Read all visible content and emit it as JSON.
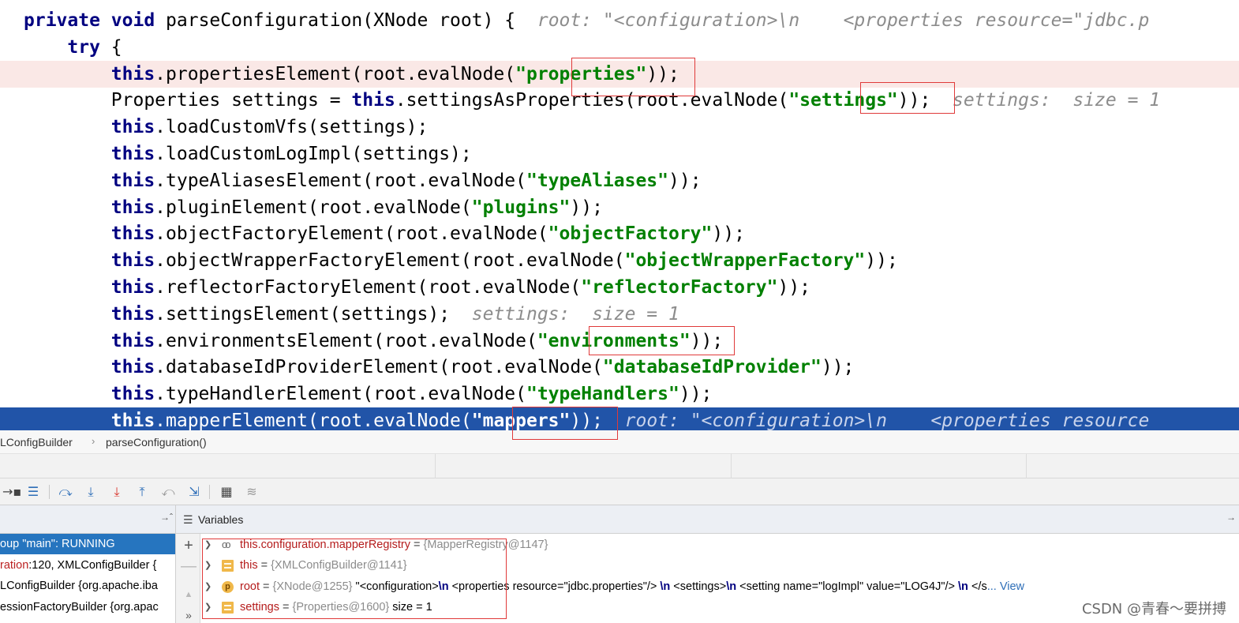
{
  "editor": {
    "lines": [
      {
        "state": "normal",
        "segments": [
          {
            "t": "private",
            "c": "kw"
          },
          {
            "t": " "
          },
          {
            "t": "void",
            "c": "kw"
          },
          {
            "t": " parseConfiguration(XNode root) {  "
          },
          {
            "t": "root: \"<configuration>\\n    <properties resource=\"jdbc.p",
            "c": "hint"
          }
        ]
      },
      {
        "state": "normal",
        "segments": [
          {
            "t": "    "
          },
          {
            "t": "try",
            "c": "kw"
          },
          {
            "t": " {"
          }
        ]
      },
      {
        "state": "error",
        "segments": [
          {
            "t": "        "
          },
          {
            "t": "this",
            "c": "kw"
          },
          {
            "t": ".propertiesElement(root.evalNode("
          },
          {
            "t": "\"properties\"",
            "c": "str"
          },
          {
            "t": "));"
          }
        ]
      },
      {
        "state": "normal",
        "segments": [
          {
            "t": "        Properties settings = "
          },
          {
            "t": "this",
            "c": "kw"
          },
          {
            "t": ".settingsAsProperties(root.evalNode("
          },
          {
            "t": "\"settings\"",
            "c": "str"
          },
          {
            "t": "));  "
          },
          {
            "t": "settings:  size = 1",
            "c": "hint"
          }
        ]
      },
      {
        "state": "normal",
        "segments": [
          {
            "t": "        "
          },
          {
            "t": "this",
            "c": "kw"
          },
          {
            "t": ".loadCustomVfs(settings);"
          }
        ]
      },
      {
        "state": "normal",
        "segments": [
          {
            "t": "        "
          },
          {
            "t": "this",
            "c": "kw"
          },
          {
            "t": ".loadCustomLogImpl(settings);"
          }
        ]
      },
      {
        "state": "normal",
        "segments": [
          {
            "t": "        "
          },
          {
            "t": "this",
            "c": "kw"
          },
          {
            "t": ".typeAliasesElement(root.evalNode("
          },
          {
            "t": "\"typeAliases\"",
            "c": "str"
          },
          {
            "t": "));"
          }
        ]
      },
      {
        "state": "normal",
        "segments": [
          {
            "t": "        "
          },
          {
            "t": "this",
            "c": "kw"
          },
          {
            "t": ".pluginElement(root.evalNode("
          },
          {
            "t": "\"plugins\"",
            "c": "str"
          },
          {
            "t": "));"
          }
        ]
      },
      {
        "state": "normal",
        "segments": [
          {
            "t": "        "
          },
          {
            "t": "this",
            "c": "kw"
          },
          {
            "t": ".objectFactoryElement(root.evalNode("
          },
          {
            "t": "\"objectFactory\"",
            "c": "str"
          },
          {
            "t": "));"
          }
        ]
      },
      {
        "state": "normal",
        "segments": [
          {
            "t": "        "
          },
          {
            "t": "this",
            "c": "kw"
          },
          {
            "t": ".objectWrapperFactoryElement(root.evalNode("
          },
          {
            "t": "\"objectWrapperFactory\"",
            "c": "str"
          },
          {
            "t": "));"
          }
        ]
      },
      {
        "state": "normal",
        "segments": [
          {
            "t": "        "
          },
          {
            "t": "this",
            "c": "kw"
          },
          {
            "t": ".reflectorFactoryElement(root.evalNode("
          },
          {
            "t": "\"reflectorFactory\"",
            "c": "str"
          },
          {
            "t": "));"
          }
        ]
      },
      {
        "state": "normal",
        "segments": [
          {
            "t": "        "
          },
          {
            "t": "this",
            "c": "kw"
          },
          {
            "t": ".settingsElement(settings);  "
          },
          {
            "t": "settings:  size = 1",
            "c": "hint"
          }
        ]
      },
      {
        "state": "normal",
        "segments": [
          {
            "t": "        "
          },
          {
            "t": "this",
            "c": "kw"
          },
          {
            "t": ".environmentsElement(root.evalNode("
          },
          {
            "t": "\"environments\"",
            "c": "str"
          },
          {
            "t": "));"
          }
        ]
      },
      {
        "state": "normal",
        "segments": [
          {
            "t": "        "
          },
          {
            "t": "this",
            "c": "kw"
          },
          {
            "t": ".databaseIdProviderElement(root.evalNode("
          },
          {
            "t": "\"databaseIdProvider\"",
            "c": "str"
          },
          {
            "t": "));"
          }
        ]
      },
      {
        "state": "normal",
        "segments": [
          {
            "t": "        "
          },
          {
            "t": "this",
            "c": "kw"
          },
          {
            "t": ".typeHandlerElement(root.evalNode("
          },
          {
            "t": "\"typeHandlers\"",
            "c": "str"
          },
          {
            "t": "));"
          }
        ]
      },
      {
        "state": "current",
        "segments": [
          {
            "t": "        "
          },
          {
            "t": "this",
            "c": "kw"
          },
          {
            "t": ".mapperElement(root.evalNode("
          },
          {
            "t": "\"mappers\"",
            "c": "str"
          },
          {
            "t": "));  "
          },
          {
            "t": "root: \"<configuration>\\n    <properties resource",
            "c": "hint"
          }
        ]
      }
    ]
  },
  "breadcrumb": {
    "items": [
      "LConfigBuilder",
      "parseConfiguration()"
    ],
    "separator": "›"
  },
  "toolbar": {
    "buttons": [
      {
        "name": "restore-layout-icon",
        "glyph": "→▪",
        "tone": "dark"
      },
      {
        "name": "show-execution-point-icon",
        "glyph": "☰",
        "tone": "blue"
      },
      {
        "name": "step-over-icon",
        "glyph": "⤼",
        "tone": "blue"
      },
      {
        "name": "step-into-icon",
        "glyph": "⤓",
        "tone": "blue"
      },
      {
        "name": "force-step-into-icon",
        "glyph": "⤓",
        "tone": "red"
      },
      {
        "name": "step-out-icon",
        "glyph": "⤒",
        "tone": "blue"
      },
      {
        "name": "drop-frame-icon",
        "glyph": "⤺",
        "tone": "gray"
      },
      {
        "name": "run-to-cursor-icon",
        "glyph": "⇲",
        "tone": "blue"
      },
      {
        "name": "evaluate-expression-icon",
        "glyph": "▦",
        "tone": "dark"
      },
      {
        "name": "trace-current-stream-icon",
        "glyph": "≋",
        "tone": "gray"
      }
    ]
  },
  "frames": {
    "pin": "→ˆ",
    "items": [
      {
        "text": "oup \"main\": RUNNING",
        "selected": true
      },
      {
        "pre": "ration",
        "text": ":120, XMLConfigBuilder {",
        "selected": false
      },
      {
        "text": "LConfigBuilder {org.apache.iba",
        "selected": false
      },
      {
        "text": "essionFactoryBuilder {org.apac",
        "selected": false
      }
    ]
  },
  "variables": {
    "title": "Variables",
    "pin": "→",
    "side_buttons": [
      {
        "name": "add-watch-icon",
        "glyph": "+",
        "enabled": true
      },
      {
        "name": "remove-watch-icon",
        "glyph": "—",
        "enabled": false
      },
      {
        "name": "move-up-icon",
        "glyph": "▲",
        "enabled": false
      },
      {
        "name": "more-icon",
        "glyph": "»",
        "enabled": true
      }
    ],
    "items": [
      {
        "icon": "watch",
        "icon_label": "oo",
        "name": "this.configuration.mapperRegistry",
        "op": " = ",
        "ref": "{MapperRegistry@1147}",
        "rest": []
      },
      {
        "icon": "field",
        "icon_label": "",
        "name": "this",
        "op": " = ",
        "ref": "{XMLConfigBuilder@1141}",
        "rest": []
      },
      {
        "icon": "param",
        "icon_label": "p",
        "name": "root",
        "op": " = ",
        "ref": "{XNode@1255}",
        "rest": [
          {
            "t": " \"<configuration>",
            "c": "vstr"
          },
          {
            "t": "\\n",
            "c": "vesc"
          },
          {
            "t": "    <properties resource=\"jdbc.properties\"/>   ",
            "c": "vstr"
          },
          {
            "t": "\\n",
            "c": "vesc"
          },
          {
            "t": "   <settings>",
            "c": "vstr"
          },
          {
            "t": "\\n",
            "c": "vesc"
          },
          {
            "t": "       <setting name=\"logImpl\" value=\"LOG4J\"/>     ",
            "c": "vstr"
          },
          {
            "t": "\\n",
            "c": "vesc"
          },
          {
            "t": "   </s",
            "c": "vstr"
          },
          {
            "t": "... View",
            "c": "vlink"
          }
        ]
      },
      {
        "icon": "field",
        "icon_label": "",
        "name": "settings",
        "op": " = ",
        "ref": "{Properties@1600}",
        "rest": [
          {
            "t": "  size = 1",
            "c": "vstr"
          }
        ]
      }
    ]
  },
  "watermark": "CSDN @青春～要拼搏",
  "colors": {
    "keyword": "#000080",
    "string": "#008000",
    "current_line": "#2154a8",
    "error_line": "#fae8e6",
    "highlight_box": "#e03a3a",
    "selected_frame": "#2675bf"
  }
}
